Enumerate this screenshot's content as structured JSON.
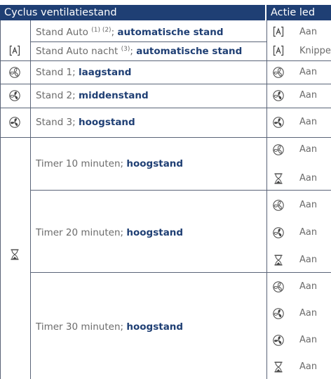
{
  "header": {
    "left": "Cyclus ventilatiestand",
    "right": "Actie led"
  },
  "rows": {
    "auto": {
      "name": "Stand Auto",
      "sup": "(1) (2)",
      "sep": ";",
      "mode": "automatische stand",
      "led": "Aan"
    },
    "auto_nacht": {
      "name": "Stand Auto nacht",
      "sup": "(3)",
      "sep": ";",
      "mode": "automatische stand",
      "led": "Knippert"
    },
    "stand1": {
      "name": "Stand 1;",
      "mode": "laagstand",
      "led": "Aan"
    },
    "stand2": {
      "name": "Stand 2;",
      "mode": "middenstand",
      "led": "Aan"
    },
    "stand3": {
      "name": "Stand 3;",
      "mode": "hoogstand",
      "led": "Aan"
    },
    "timer10": {
      "name": "Timer 10 minuten;",
      "mode": "hoogstand",
      "leds": [
        "Aan",
        "Aan"
      ]
    },
    "timer20": {
      "name": "Timer 20 minuten;",
      "mode": "hoogstand",
      "leds": [
        "Aan",
        "Aan",
        "Aan"
      ]
    },
    "timer30": {
      "name": "Timer 30 minuten;",
      "mode": "hoogstand",
      "leds": [
        "Aan",
        "Aan",
        "Aan",
        "Aan"
      ]
    }
  },
  "icons": [
    "auto-mode-icon",
    "fan-speed-1-icon",
    "fan-speed-2-icon",
    "fan-speed-3-icon",
    "hourglass-icon"
  ],
  "colors": {
    "header_bg": "#1f3f74",
    "accent_text": "#1f3f74",
    "body_text": "#6b6b6b",
    "rule": "#5a6478"
  }
}
